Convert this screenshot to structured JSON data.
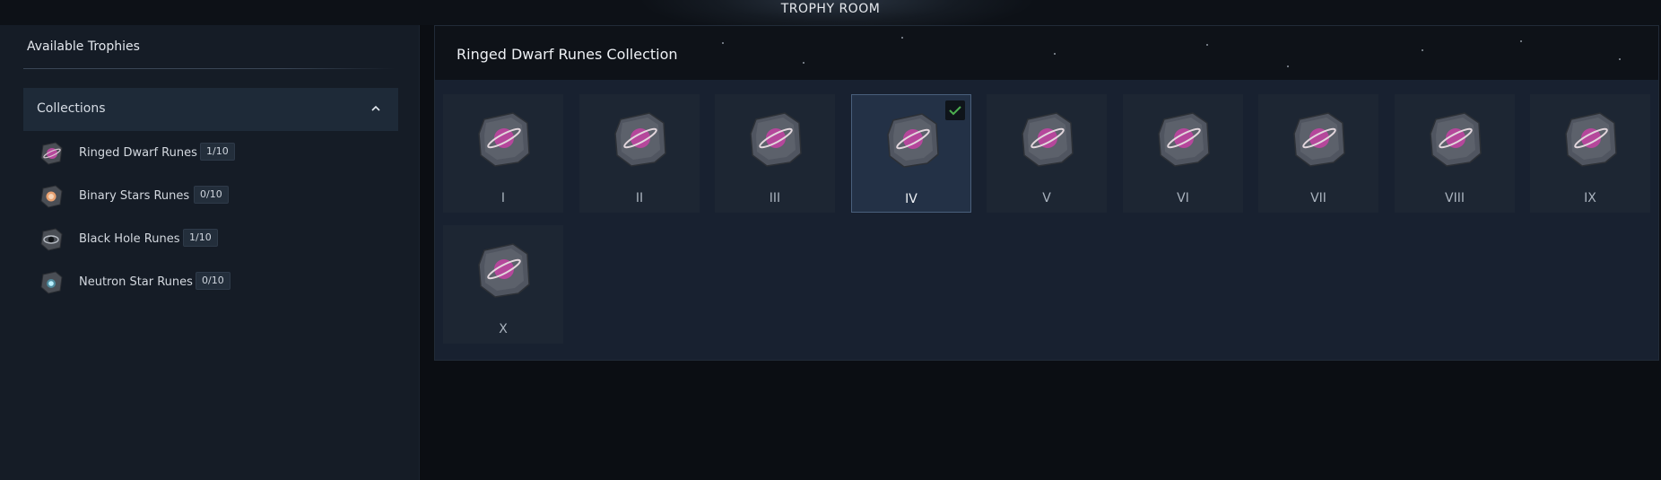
{
  "window": {
    "title": "TROPHY ROOM"
  },
  "sidebar": {
    "title": "Available Trophies",
    "collections_label": "Collections",
    "items": [
      {
        "name": "Ringed Dwarf Runes",
        "count": "1/10",
        "icon": "ringed-dwarf-rune-icon"
      },
      {
        "name": "Binary Stars Runes",
        "count": "0/10",
        "icon": "binary-stars-rune-icon"
      },
      {
        "name": "Black Hole Runes",
        "count": "1/10",
        "icon": "black-hole-rune-icon"
      },
      {
        "name": "Neutron Star Runes",
        "count": "0/10",
        "icon": "neutron-star-rune-icon"
      }
    ]
  },
  "main": {
    "title": "Ringed Dwarf Runes Collection",
    "runes": [
      {
        "label": "I",
        "selected": false,
        "collected": false
      },
      {
        "label": "II",
        "selected": false,
        "collected": false
      },
      {
        "label": "III",
        "selected": false,
        "collected": false
      },
      {
        "label": "IV",
        "selected": true,
        "collected": true
      },
      {
        "label": "V",
        "selected": false,
        "collected": false
      },
      {
        "label": "VI",
        "selected": false,
        "collected": false
      },
      {
        "label": "VII",
        "selected": false,
        "collected": false
      },
      {
        "label": "VIII",
        "selected": false,
        "collected": false
      },
      {
        "label": "IX",
        "selected": false,
        "collected": false
      },
      {
        "label": "X",
        "selected": false,
        "collected": false
      }
    ]
  },
  "colors": {
    "accent_check": "#4caf50",
    "rune_planet": "#b5479b",
    "selected_border": "#4a607c"
  }
}
